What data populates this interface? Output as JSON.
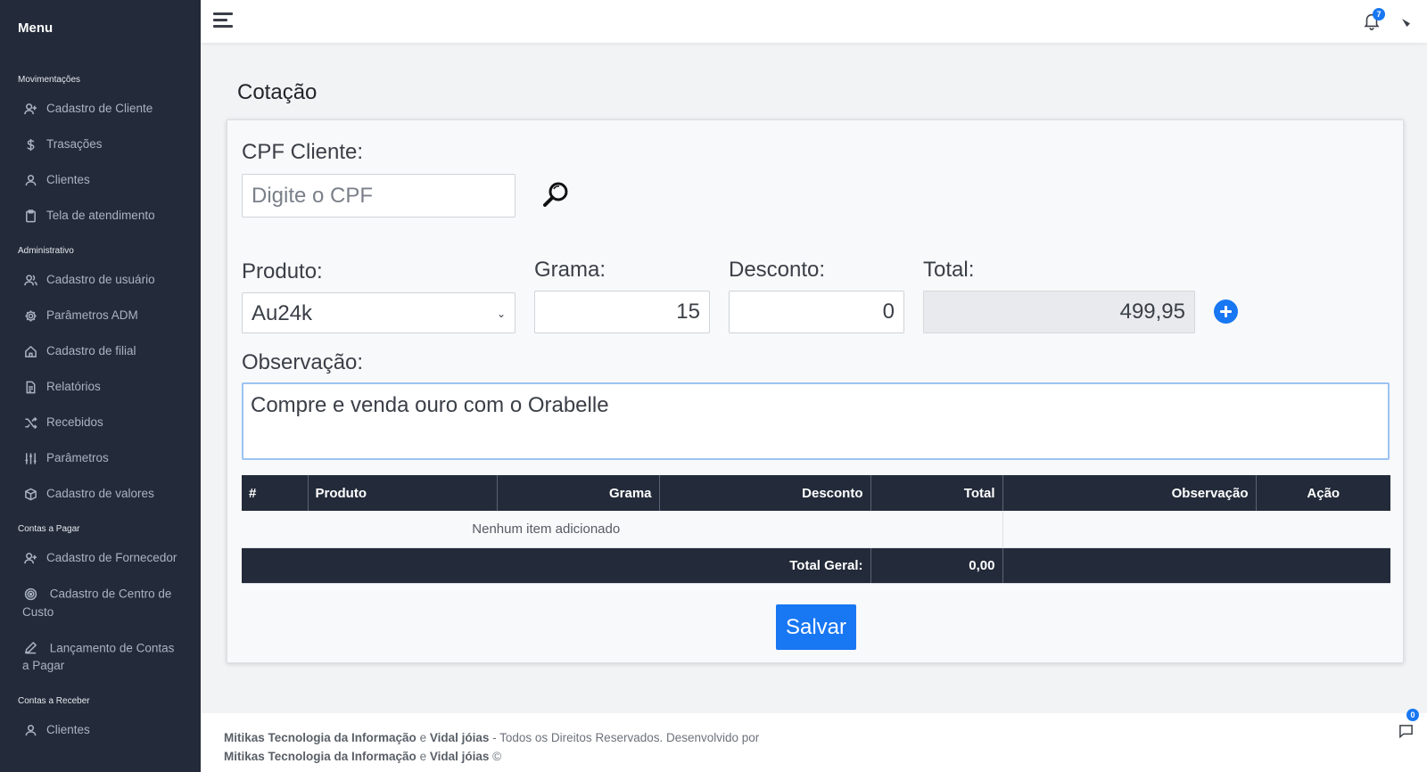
{
  "sidebar": {
    "title": "Menu",
    "sections": [
      {
        "label": "Movimentações",
        "items": [
          {
            "label": "Cadastro de Cliente",
            "icon": "user-plus-icon"
          },
          {
            "label": "Trasações",
            "icon": "dollar-icon"
          },
          {
            "label": "Clientes",
            "icon": "user-icon"
          },
          {
            "label": "Tela de atendimento",
            "icon": "clipboard-icon"
          }
        ]
      },
      {
        "label": "Administrativo",
        "items": [
          {
            "label": "Cadastro de usuário",
            "icon": "users-icon"
          },
          {
            "label": "Parâmetros ADM",
            "icon": "gear-icon"
          },
          {
            "label": "Cadastro de filial",
            "icon": "home-icon"
          },
          {
            "label": "Relatórios",
            "icon": "document-icon"
          },
          {
            "label": "Recebidos",
            "icon": "shuffle-icon"
          },
          {
            "label": "Parâmetros",
            "icon": "sliders-icon"
          },
          {
            "label": "Cadastro de valores",
            "icon": "box-icon"
          }
        ]
      },
      {
        "label": "Contas a Pagar",
        "items": [
          {
            "label": "Cadastro de Fornecedor",
            "icon": "user-plus-icon"
          },
          {
            "label": "Cadastro de Centro de Custo",
            "icon": "target-icon"
          },
          {
            "label": "Lançamento de Contas a Pagar",
            "icon": "pen-icon"
          }
        ]
      },
      {
        "label": "Contas a Receber",
        "items": [
          {
            "label": "Clientes",
            "icon": "user-icon"
          }
        ]
      }
    ]
  },
  "topbar": {
    "notification_count": "7",
    "menu_icon": "hamburger-icon",
    "bell_icon": "bell-icon"
  },
  "page": {
    "title": "Cotação"
  },
  "form": {
    "cpf_label": "CPF Cliente:",
    "cpf_placeholder": "Digite o CPF",
    "produto_label": "Produto:",
    "produto_value": "Au24k",
    "grama_label": "Grama:",
    "grama_value": "15",
    "desconto_label": "Desconto:",
    "desconto_value": "0",
    "total_label": "Total:",
    "total_value": "499,95",
    "observacao_label": "Observação:",
    "observacao_value": "Compre e venda ouro com o Orabelle",
    "save_label": "Salvar"
  },
  "table": {
    "headers": [
      "#",
      "Produto",
      "Grama",
      "Desconto",
      "Total",
      "Observação",
      "Ação"
    ],
    "empty_message": "Nenhum item adicionado",
    "total_geral_label": "Total Geral:",
    "total_geral_value": "0,00"
  },
  "footer": {
    "company": "Mitikas Tecnologia da Informação",
    "conj": "e",
    "client": "Vidal jóias",
    "rights": "- Todos os Direitos Reservados. Desenvolvido por",
    "copyright": "©"
  },
  "chat": {
    "count": "0"
  },
  "colors": {
    "sidebar_bg": "#232b3a",
    "accent": "#1877f2",
    "table_header_bg": "#232b3a"
  }
}
